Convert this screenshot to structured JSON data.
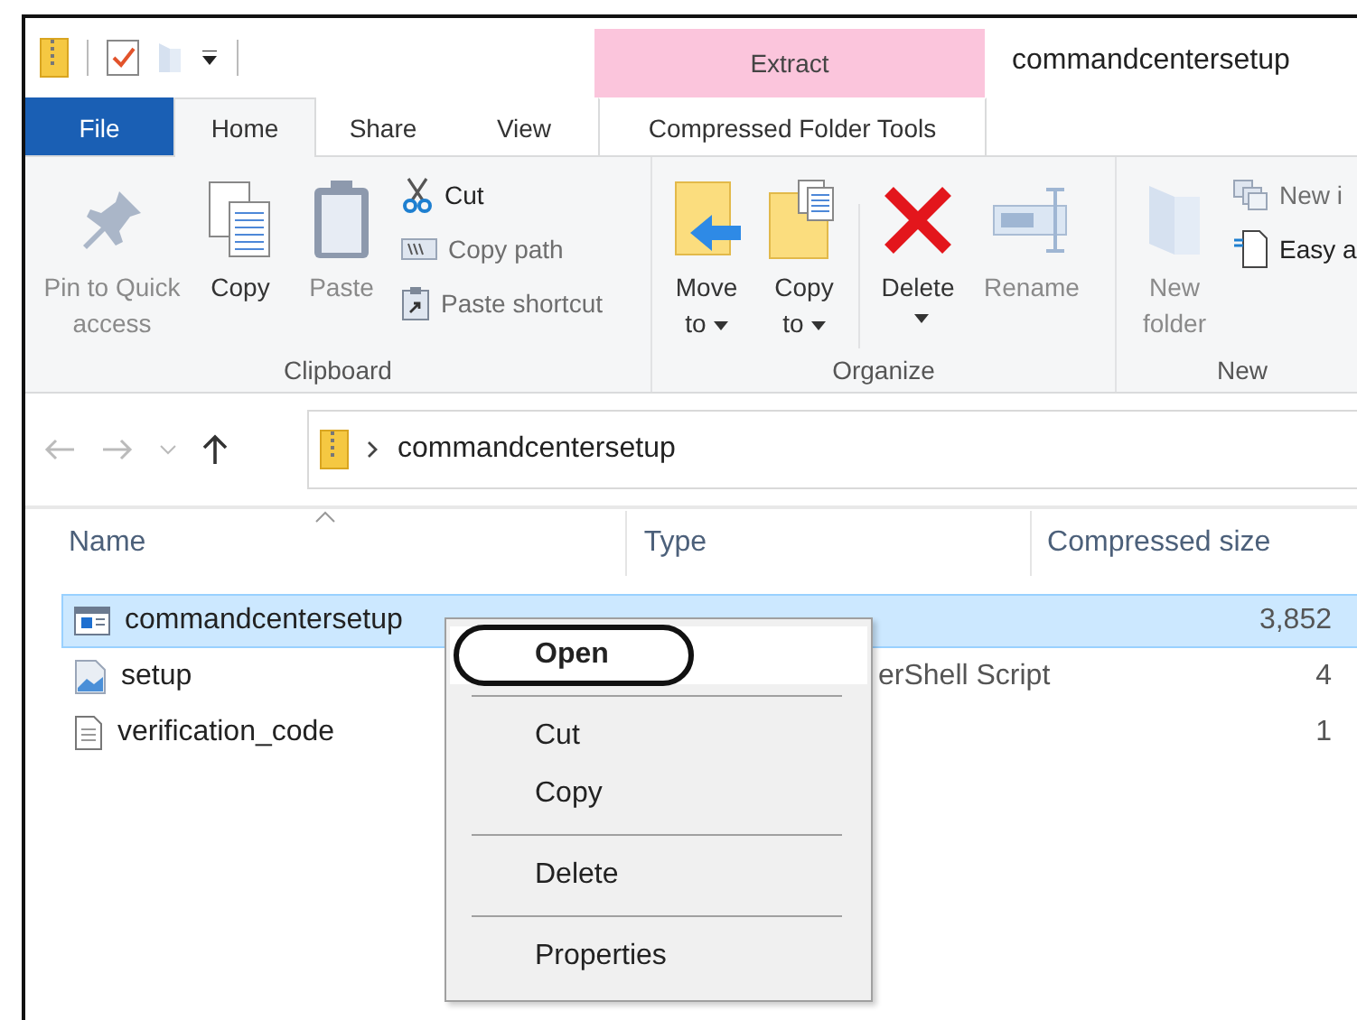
{
  "window": {
    "title": "commandcentersetup"
  },
  "contextual_group": {
    "label": "Extract"
  },
  "tabs": [
    {
      "label": "File",
      "kind": "file",
      "selected": false
    },
    {
      "label": "Home",
      "kind": "tab",
      "selected": true
    },
    {
      "label": "Share",
      "kind": "tab",
      "selected": false
    },
    {
      "label": "View",
      "kind": "tab",
      "selected": false
    },
    {
      "label": "Compressed Folder Tools",
      "kind": "contextual",
      "selected": false
    }
  ],
  "ribbon": {
    "groups": [
      {
        "label": "Clipboard",
        "commands": [
          {
            "label": "Pin to Quick access",
            "kind": "large",
            "disabled": true
          },
          {
            "label": "Copy",
            "kind": "large",
            "disabled": false
          },
          {
            "label": "Paste",
            "kind": "large",
            "disabled": true
          },
          {
            "kind": "stack",
            "items": [
              {
                "label": "Cut",
                "disabled": false
              },
              {
                "label": "Copy path",
                "disabled": true
              },
              {
                "label": "Paste shortcut",
                "disabled": true
              }
            ]
          }
        ]
      },
      {
        "label": "Organize",
        "commands": [
          {
            "label": "Move to",
            "kind": "menu",
            "disabled": false
          },
          {
            "label": "Copy to",
            "kind": "menu",
            "disabled": false
          },
          {
            "kind": "divider"
          },
          {
            "label": "Delete",
            "kind": "split",
            "disabled": false
          },
          {
            "label": "Rename",
            "kind": "large",
            "disabled": true
          }
        ]
      },
      {
        "label": "New",
        "commands": [
          {
            "label": "New folder",
            "kind": "large",
            "disabled": true
          },
          {
            "kind": "stack",
            "items": [
              {
                "label": "New i",
                "disabled": true
              },
              {
                "label": "Easy a",
                "disabled": false
              }
            ]
          }
        ]
      }
    ]
  },
  "address": {
    "path": "commandcentersetup"
  },
  "columns": [
    {
      "label": "Name",
      "sorted": true
    },
    {
      "label": "Type",
      "sorted": false
    },
    {
      "label": "Compressed size",
      "sorted": false
    }
  ],
  "rows": [
    {
      "name": "commandcentersetup",
      "kind": "app",
      "size": "3,852",
      "selected": true
    },
    {
      "name": "setup",
      "kind": "script",
      "type": "erShell Script",
      "size": "4",
      "selected": false
    },
    {
      "name": "verification_code",
      "kind": "text",
      "size": "1",
      "selected": false
    }
  ],
  "context_menu": [
    {
      "kind": "item",
      "label": "Open",
      "default": true,
      "highlighted": true,
      "circled": true
    },
    {
      "kind": "separator"
    },
    {
      "kind": "item",
      "label": "Cut",
      "default": false,
      "highlighted": false,
      "circled": false
    },
    {
      "kind": "item",
      "label": "Copy",
      "default": false,
      "highlighted": false,
      "circled": false
    },
    {
      "kind": "separator"
    },
    {
      "kind": "item",
      "label": "Delete",
      "default": false,
      "highlighted": false,
      "circled": false
    },
    {
      "kind": "separator"
    },
    {
      "kind": "item",
      "label": "Properties",
      "default": false,
      "highlighted": false,
      "circled": false
    }
  ]
}
